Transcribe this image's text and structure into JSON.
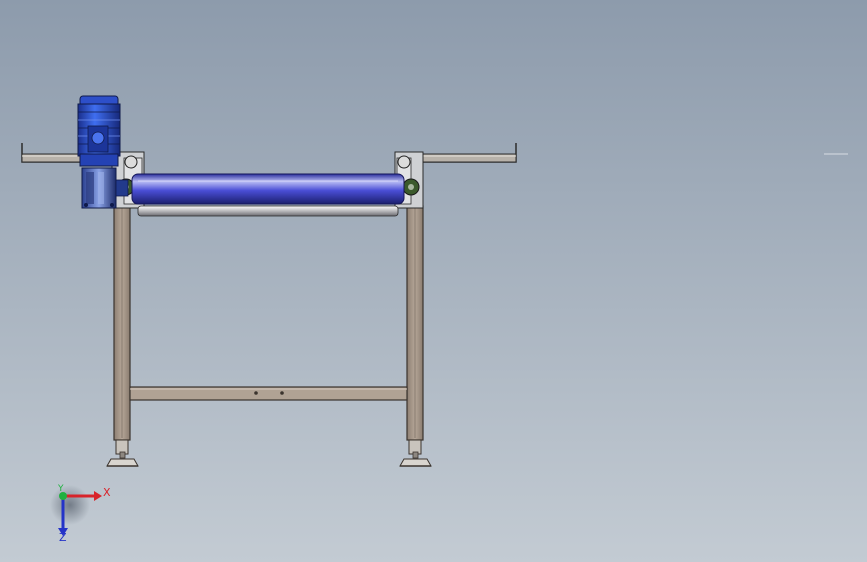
{
  "viewport": {
    "background_top": "#8d9bac",
    "background_bottom": "#c3cbd3"
  },
  "model": {
    "frame_color": "#a9998b",
    "frame_outline": "#3a332d",
    "roller_color": "#4a4ed6",
    "motor_color": "#2a4fd2"
  },
  "triad": {
    "x_label": "X",
    "y_label": "Y",
    "z_label": "Z",
    "x_color": "#d8232a",
    "y_color": "#20b040",
    "z_color": "#2433c8"
  },
  "icons": [
    "coordinate-triad-icon"
  ]
}
